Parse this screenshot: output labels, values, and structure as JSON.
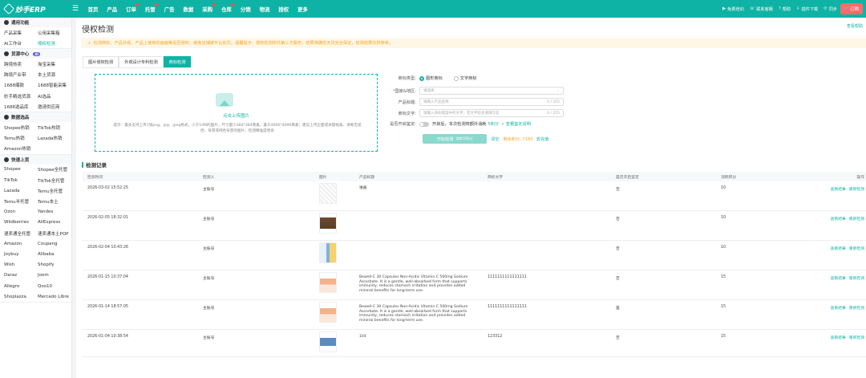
{
  "topbar": {
    "brand": "妙手ERP",
    "nav": [
      "首页",
      "产品",
      "订单",
      "托管",
      "广告",
      "数据",
      "采购",
      "仓库",
      "分销",
      "物流",
      "授权",
      "更多"
    ],
    "tools": [
      "免费培训",
      "联系客服",
      "帮助",
      "插件下载",
      "同步"
    ],
    "order_label": "订购"
  },
  "sidebar": {
    "groups": [
      {
        "title": "通用功能",
        "rows": [
          [
            "产品采集",
            "公用采集箱"
          ],
          [
            "AI工作台",
            "侵权检测"
          ]
        ]
      },
      {
        "title": "货源中心",
        "tag": "AI",
        "rows": [
          [
            "跨境热卖",
            "淘宝采集"
          ],
          [
            "跨境产业带",
            "本土货源"
          ],
          [
            "1688爆款",
            "1688智能采集"
          ],
          [
            "妙手精选货源",
            "AI选品"
          ],
          [
            "1688选品库",
            "邀请供应商"
          ]
        ]
      },
      {
        "title": "数据选品",
        "rows": [
          [
            "Shopee热销",
            "TikTok热销"
          ],
          [
            "Temu热销",
            "Lazada热销"
          ],
          [
            "Amazon热销",
            ""
          ]
        ]
      },
      {
        "title": "快速上货",
        "rows": [
          [
            "Shopee",
            "Shopee全托管"
          ],
          [
            "TikTok",
            "TikTok全托管"
          ],
          [
            "Lazada",
            "Temu全托管"
          ],
          [
            "Temu半托管",
            "Temu本土"
          ],
          [
            "Ozon",
            "Yandex"
          ],
          [
            "Wildberries",
            "AliExpress"
          ],
          [
            "速卖通全托管",
            "速卖通本土POP"
          ],
          [
            "Amazon",
            "Coupang"
          ],
          [
            "Joybuy",
            "Alibaba"
          ],
          [
            "Wish",
            "Shopify"
          ],
          [
            "Daraz",
            "Joom"
          ],
          [
            "Allegro",
            "Qoo10"
          ],
          [
            "Shoplazza",
            "Mercado Libre"
          ]
        ]
      }
    ]
  },
  "page": {
    "title": "侵权检测",
    "help": "查看帮助",
    "notice": "检测商标、产品外观、产品上使用的画面等是否侵权，避免店铺被平台处罚。温馨提示：侵权检测依托第三方服务，结果准确性无法完全保证，检测结果仅供参考。",
    "tabs": [
      "图片侵权检测",
      "外观设计专利检测",
      "商标检测"
    ]
  },
  "upload": {
    "label": "点击上传图片",
    "hint": "提示：最多支持上传1张png、jpg、jpeg格式，小于10M的图片；尺寸最小384*384像素，最大4096*4096像素；建议上传正面或关键视角、清晰无遮挡、背景或纯色背景的图片，检测精准度更高"
  },
  "form": {
    "type_label": "商标类型:",
    "type_options": [
      "图形商标",
      "文字商标"
    ],
    "region_label": "国家&地区:",
    "region_placeholder": "请选择",
    "ptitle_label": "产品标题:",
    "ptitle_placeholder": "请输入产品名称",
    "ptitle_count": "0 / 255",
    "text_label": "商标文字:",
    "text_placeholder": "请输入商标图案中的文字，若文字较多请填写前",
    "text_count": "0 / 255",
    "deep_label": "是否开启鉴定:",
    "deep_text": "开启后，本次检测将额外消耗",
    "deep_points": "5积分",
    "deep_link": "查看鉴定说明",
    "start_button": "开始检测",
    "start_sub": "消耗10积分",
    "clear_label": "清空",
    "points_text": "剩余积分: 7180",
    "buy_label": "去充值"
  },
  "records": {
    "title": "检测记录",
    "columns": [
      "检测时间",
      "检测人",
      "图片",
      "产品标题",
      "商标文字",
      "是否开启鉴定",
      "消耗积分",
      "操作"
    ],
    "op_view": "查看结果",
    "op_redo": "重新检测",
    "rows": [
      {
        "time": "2026-03-02 15:52:25",
        "user": "主账号",
        "ptitle": "谁器",
        "mtext": "",
        "deep": "否",
        "points": "10"
      },
      {
        "time": "2026-02-05 18:32:01",
        "user": "主账号",
        "ptitle": "",
        "mtext": "",
        "deep": "否",
        "points": "10"
      },
      {
        "time": "2026-02-04 10:43:26",
        "user": "主账号",
        "ptitle": "",
        "mtext": "",
        "deep": "否",
        "points": "10"
      },
      {
        "time": "2026-01-15 10:37:04",
        "user": "主账号",
        "ptitle": "Bewell-C 30 Capsules Non-Acidic Vitamin C 500mg Sodium Ascorbate. It is a gentle, well-absorbed form that supports immunity, reduces stomach irritation and provides added mineral benefits for long-term use.",
        "mtext": "1111111111111111",
        "deep": "否",
        "points": "15"
      },
      {
        "time": "2026-01-14 18:57:05",
        "user": "主账号",
        "ptitle": "Bewell-C 30 Capsules Non-Acidic Vitamin C 500mg Sodium Ascorbate. It is a gentle, well-absorbed form that supports immunity, reduces stomach irritation and provides added mineral benefits for long-term use.",
        "mtext": "1111111111111111",
        "deep": "是",
        "points": "15"
      },
      {
        "time": "2026-01-04 10:38:54",
        "user": "主账号",
        "ptitle": "104",
        "mtext": "123312",
        "deep": "否",
        "points": "15"
      }
    ]
  }
}
